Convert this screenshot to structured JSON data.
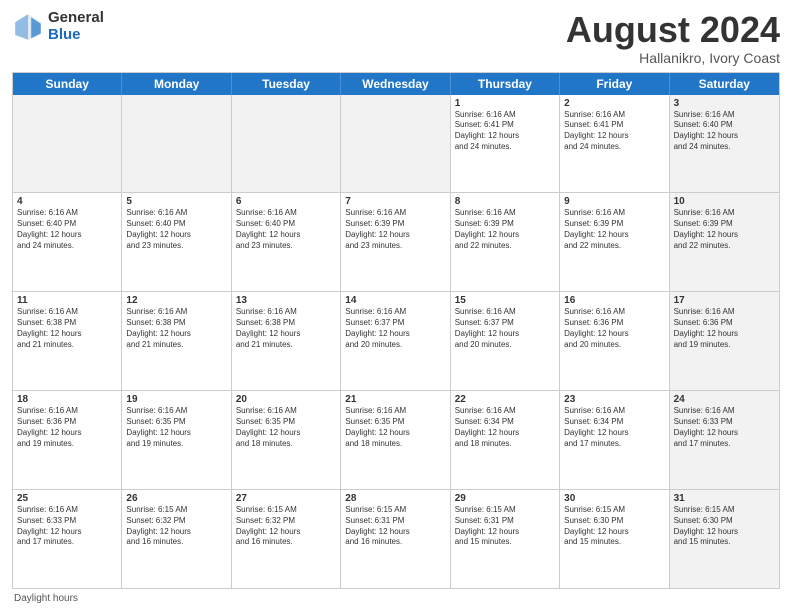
{
  "header": {
    "logo_general": "General",
    "logo_blue": "Blue",
    "title": "August 2024",
    "location": "Hallanikro, Ivory Coast"
  },
  "days": [
    "Sunday",
    "Monday",
    "Tuesday",
    "Wednesday",
    "Thursday",
    "Friday",
    "Saturday"
  ],
  "footer": {
    "note": "Daylight hours"
  },
  "weeks": [
    [
      {
        "day": "",
        "text": "",
        "shaded": true
      },
      {
        "day": "",
        "text": "",
        "shaded": true
      },
      {
        "day": "",
        "text": "",
        "shaded": true
      },
      {
        "day": "",
        "text": "",
        "shaded": true
      },
      {
        "day": "1",
        "text": "Sunrise: 6:16 AM\nSunset: 6:41 PM\nDaylight: 12 hours\nand 24 minutes.",
        "shaded": false
      },
      {
        "day": "2",
        "text": "Sunrise: 6:16 AM\nSunset: 6:41 PM\nDaylight: 12 hours\nand 24 minutes.",
        "shaded": false
      },
      {
        "day": "3",
        "text": "Sunrise: 6:16 AM\nSunset: 6:40 PM\nDaylight: 12 hours\nand 24 minutes.",
        "shaded": true
      }
    ],
    [
      {
        "day": "4",
        "text": "Sunrise: 6:16 AM\nSunset: 6:40 PM\nDaylight: 12 hours\nand 24 minutes.",
        "shaded": false
      },
      {
        "day": "5",
        "text": "Sunrise: 6:16 AM\nSunset: 6:40 PM\nDaylight: 12 hours\nand 23 minutes.",
        "shaded": false
      },
      {
        "day": "6",
        "text": "Sunrise: 6:16 AM\nSunset: 6:40 PM\nDaylight: 12 hours\nand 23 minutes.",
        "shaded": false
      },
      {
        "day": "7",
        "text": "Sunrise: 6:16 AM\nSunset: 6:39 PM\nDaylight: 12 hours\nand 23 minutes.",
        "shaded": false
      },
      {
        "day": "8",
        "text": "Sunrise: 6:16 AM\nSunset: 6:39 PM\nDaylight: 12 hours\nand 22 minutes.",
        "shaded": false
      },
      {
        "day": "9",
        "text": "Sunrise: 6:16 AM\nSunset: 6:39 PM\nDaylight: 12 hours\nand 22 minutes.",
        "shaded": false
      },
      {
        "day": "10",
        "text": "Sunrise: 6:16 AM\nSunset: 6:39 PM\nDaylight: 12 hours\nand 22 minutes.",
        "shaded": true
      }
    ],
    [
      {
        "day": "11",
        "text": "Sunrise: 6:16 AM\nSunset: 6:38 PM\nDaylight: 12 hours\nand 21 minutes.",
        "shaded": false
      },
      {
        "day": "12",
        "text": "Sunrise: 6:16 AM\nSunset: 6:38 PM\nDaylight: 12 hours\nand 21 minutes.",
        "shaded": false
      },
      {
        "day": "13",
        "text": "Sunrise: 6:16 AM\nSunset: 6:38 PM\nDaylight: 12 hours\nand 21 minutes.",
        "shaded": false
      },
      {
        "day": "14",
        "text": "Sunrise: 6:16 AM\nSunset: 6:37 PM\nDaylight: 12 hours\nand 20 minutes.",
        "shaded": false
      },
      {
        "day": "15",
        "text": "Sunrise: 6:16 AM\nSunset: 6:37 PM\nDaylight: 12 hours\nand 20 minutes.",
        "shaded": false
      },
      {
        "day": "16",
        "text": "Sunrise: 6:16 AM\nSunset: 6:36 PM\nDaylight: 12 hours\nand 20 minutes.",
        "shaded": false
      },
      {
        "day": "17",
        "text": "Sunrise: 6:16 AM\nSunset: 6:36 PM\nDaylight: 12 hours\nand 19 minutes.",
        "shaded": true
      }
    ],
    [
      {
        "day": "18",
        "text": "Sunrise: 6:16 AM\nSunset: 6:36 PM\nDaylight: 12 hours\nand 19 minutes.",
        "shaded": false
      },
      {
        "day": "19",
        "text": "Sunrise: 6:16 AM\nSunset: 6:35 PM\nDaylight: 12 hours\nand 19 minutes.",
        "shaded": false
      },
      {
        "day": "20",
        "text": "Sunrise: 6:16 AM\nSunset: 6:35 PM\nDaylight: 12 hours\nand 18 minutes.",
        "shaded": false
      },
      {
        "day": "21",
        "text": "Sunrise: 6:16 AM\nSunset: 6:35 PM\nDaylight: 12 hours\nand 18 minutes.",
        "shaded": false
      },
      {
        "day": "22",
        "text": "Sunrise: 6:16 AM\nSunset: 6:34 PM\nDaylight: 12 hours\nand 18 minutes.",
        "shaded": false
      },
      {
        "day": "23",
        "text": "Sunrise: 6:16 AM\nSunset: 6:34 PM\nDaylight: 12 hours\nand 17 minutes.",
        "shaded": false
      },
      {
        "day": "24",
        "text": "Sunrise: 6:16 AM\nSunset: 6:33 PM\nDaylight: 12 hours\nand 17 minutes.",
        "shaded": true
      }
    ],
    [
      {
        "day": "25",
        "text": "Sunrise: 6:16 AM\nSunset: 6:33 PM\nDaylight: 12 hours\nand 17 minutes.",
        "shaded": false
      },
      {
        "day": "26",
        "text": "Sunrise: 6:15 AM\nSunset: 6:32 PM\nDaylight: 12 hours\nand 16 minutes.",
        "shaded": false
      },
      {
        "day": "27",
        "text": "Sunrise: 6:15 AM\nSunset: 6:32 PM\nDaylight: 12 hours\nand 16 minutes.",
        "shaded": false
      },
      {
        "day": "28",
        "text": "Sunrise: 6:15 AM\nSunset: 6:31 PM\nDaylight: 12 hours\nand 16 minutes.",
        "shaded": false
      },
      {
        "day": "29",
        "text": "Sunrise: 6:15 AM\nSunset: 6:31 PM\nDaylight: 12 hours\nand 15 minutes.",
        "shaded": false
      },
      {
        "day": "30",
        "text": "Sunrise: 6:15 AM\nSunset: 6:30 PM\nDaylight: 12 hours\nand 15 minutes.",
        "shaded": false
      },
      {
        "day": "31",
        "text": "Sunrise: 6:15 AM\nSunset: 6:30 PM\nDaylight: 12 hours\nand 15 minutes.",
        "shaded": true
      }
    ]
  ]
}
